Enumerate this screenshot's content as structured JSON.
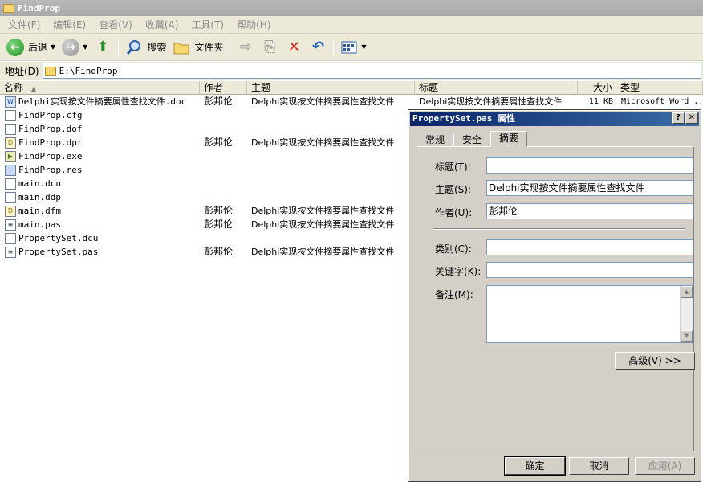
{
  "window": {
    "title": "FindProp"
  },
  "menu": [
    "文件(F)",
    "编辑(E)",
    "查看(V)",
    "收藏(A)",
    "工具(T)",
    "帮助(H)"
  ],
  "toolbar": {
    "back": "后退",
    "search": "搜索",
    "folders": "文件夹"
  },
  "address": {
    "label": "地址(D)",
    "value": "E:\\FindProp"
  },
  "columns": {
    "name": "名称",
    "author": "作者",
    "subject": "主题",
    "title": "标题",
    "size": "大小",
    "type": "类型"
  },
  "files": [
    {
      "name": "Delphi实现按文件摘要属性查找文件.doc",
      "icon": "doc-icon",
      "author": "彭邦伦",
      "subject": "Delphi实现按文件摘要属性查找文件",
      "title": "Delphi实现按文件摘要属性查找文件",
      "size": "11 KB",
      "type": "Microsoft Word ..."
    },
    {
      "name": "FindProp.cfg",
      "icon": "cfg-file-icon",
      "author": "",
      "subject": "",
      "title": "",
      "size": "",
      "type": ""
    },
    {
      "name": "FindProp.dof",
      "icon": "dof-file-icon",
      "author": "",
      "subject": "",
      "title": "",
      "size": "",
      "type": ""
    },
    {
      "name": "FindProp.dpr",
      "icon": "delphi-project-icon",
      "author": "彭邦伦",
      "subject": "Delphi实现按文件摘要属性查找文件",
      "title": "",
      "size": "",
      "type": ""
    },
    {
      "name": "FindProp.exe",
      "icon": "exe-icon",
      "author": "",
      "subject": "",
      "title": "",
      "size": "",
      "type": ""
    },
    {
      "name": "FindProp.res",
      "icon": "res-file-icon",
      "author": "",
      "subject": "",
      "title": "",
      "size": "",
      "type": ""
    },
    {
      "name": "main.dcu",
      "icon": "dcu-file-icon",
      "author": "",
      "subject": "",
      "title": "",
      "size": "",
      "type": ""
    },
    {
      "name": "main.ddp",
      "icon": "ddp-file-icon",
      "author": "",
      "subject": "",
      "title": "",
      "size": "",
      "type": ""
    },
    {
      "name": "main.dfm",
      "icon": "delphi-form-icon",
      "author": "彭邦伦",
      "subject": "Delphi实现按文件摘要属性查找文件",
      "title": "",
      "size": "",
      "type": ""
    },
    {
      "name": "main.pas",
      "icon": "pascal-file-icon",
      "author": "彭邦伦",
      "subject": "Delphi实现按文件摘要属性查找文件",
      "title": "",
      "size": "",
      "type": ""
    },
    {
      "name": "PropertySet.dcu",
      "icon": "dcu-file-icon",
      "author": "",
      "subject": "",
      "title": "",
      "size": "",
      "type": ""
    },
    {
      "name": "PropertySet.pas",
      "icon": "pascal-file-icon",
      "author": "彭邦伦",
      "subject": "Delphi实现按文件摘要属性查找文件",
      "title": "",
      "size": "",
      "type": ""
    }
  ],
  "dialog": {
    "title": "PropertySet.pas 属性",
    "help": "?",
    "close": "✕",
    "tabs": [
      "常规",
      "安全",
      "摘要"
    ],
    "active_tab": "摘要",
    "fields": {
      "title_label": "标题(T):",
      "title_value": "",
      "subject_label": "主题(S):",
      "subject_value": "Delphi实现按文件摘要属性查找文件",
      "author_label": "作者(U):",
      "author_value": "彭邦伦",
      "category_label": "类别(C):",
      "category_value": "",
      "keywords_label": "关键字(K):",
      "keywords_value": "",
      "comments_label": "备注(M):",
      "comments_value": ""
    },
    "advanced": "高级(V) >>",
    "ok": "确定",
    "cancel": "取消",
    "apply": "应用(A)"
  }
}
